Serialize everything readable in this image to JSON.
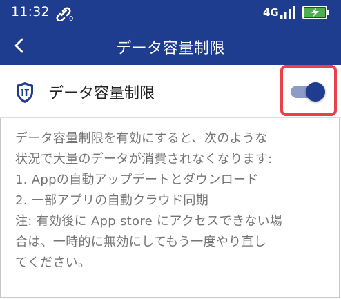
{
  "status_bar": {
    "time": "11:32",
    "network": "4G",
    "link_icon": "link-icon",
    "signal_icon": "signal-icon",
    "battery_icon": "battery-charging-icon",
    "battery_color": "#4caf50"
  },
  "app_bar": {
    "back_icon": "chevron-left-icon",
    "title": "データ容量制限",
    "background": "#1f3d8f"
  },
  "setting": {
    "icon": "shield-icon",
    "label": "データ容量制限",
    "toggle_on": true,
    "toggle_color": "#1f3d8f",
    "highlight_color": "#e8414a"
  },
  "description": {
    "lines": [
      "データ容量制限を有効にすると、次のような",
      "状況で大量のデータが消費されなくなります:",
      "1. Appの自動アップデートとダウンロード",
      "2. 一部アプリの自動クラウド同期",
      " 注: 有効後に App store にアクセスできない場",
      "合は、一時的に無効にしてもう一度やり直し",
      "てください。"
    ]
  }
}
